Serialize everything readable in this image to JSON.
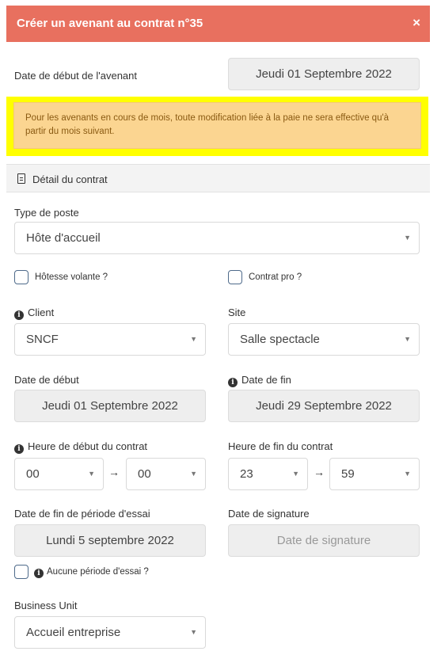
{
  "header": {
    "title": "Créer un avenant au contrat n°35",
    "close_label": "×"
  },
  "avenant_start": {
    "label": "Date de début de l'avenant",
    "value": "Jeudi 01 Septembre 2022"
  },
  "alert": {
    "text": "Pour les avenants en cours de mois, toute modification liée à la paie ne sera effective qu'à partir du mois suivant."
  },
  "section": {
    "title": "Détail du contrat"
  },
  "type_poste": {
    "label": "Type de poste",
    "value": "Hôte d'accueil"
  },
  "hotesse_volante": {
    "label": "Hôtesse volante ?",
    "checked": false
  },
  "contrat_pro": {
    "label": "Contrat pro ?",
    "checked": false
  },
  "client": {
    "label": "Client",
    "value": "SNCF"
  },
  "site": {
    "label": "Site",
    "value": "Salle spectacle"
  },
  "date_debut": {
    "label": "Date de début",
    "value": "Jeudi 01 Septembre 2022"
  },
  "date_fin": {
    "label": "Date de fin",
    "value": "Jeudi 29 Septembre 2022"
  },
  "heure_debut": {
    "label": "Heure de début du contrat",
    "hour": "00",
    "minute": "00"
  },
  "heure_fin": {
    "label": "Heure de fin du contrat",
    "hour": "23",
    "minute": "59"
  },
  "fin_essai": {
    "label": "Date de fin de période d'essai",
    "value": "Lundi 5 septembre 2022"
  },
  "signature": {
    "label": "Date de signature",
    "placeholder": "Date de signature"
  },
  "aucune_essai": {
    "label": "Aucune période d'essai ?",
    "checked": false
  },
  "business_unit": {
    "label": "Business Unit",
    "value": "Accueil entreprise"
  },
  "icons": {
    "info": "i",
    "caret": "▼",
    "arrow": "→"
  },
  "colors": {
    "header_bg": "#e8705f",
    "alert_bg": "#fbd591",
    "highlight": "#ffff00"
  }
}
